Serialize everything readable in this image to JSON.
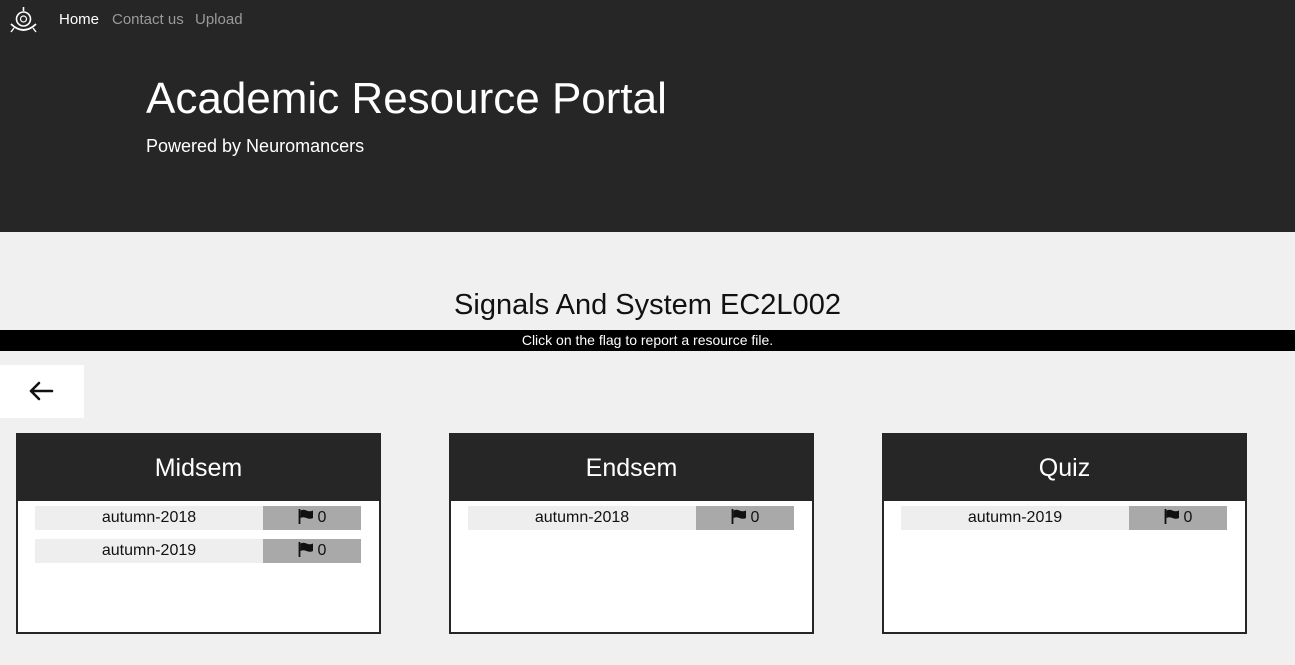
{
  "nav": {
    "logo_icon": "institute-emblem-icon",
    "links": [
      {
        "label": "Home",
        "active": true
      },
      {
        "label": "Contact us",
        "active": false
      },
      {
        "label": "Upload",
        "active": false
      }
    ]
  },
  "hero": {
    "title": "Academic Resource Portal",
    "subtitle": "Powered by Neuromancers"
  },
  "course": {
    "title": "Signals And System EC2L002"
  },
  "notice": "Click on the flag to report a resource file.",
  "back_button": {
    "icon": "arrow-left-icon"
  },
  "colors": {
    "header_bg": "#262626",
    "page_bg": "#f0f0f0",
    "notice_bg": "#000000",
    "flag_cell_bg": "#a9a9a9",
    "file_cell_bg": "#eeeeee"
  },
  "sections": [
    {
      "title": "Midsem",
      "files": [
        {
          "name": "autumn-2018",
          "flags": "0"
        },
        {
          "name": "autumn-2019",
          "flags": "0"
        }
      ]
    },
    {
      "title": "Endsem",
      "files": [
        {
          "name": "autumn-2018",
          "flags": "0"
        }
      ]
    },
    {
      "title": "Quiz",
      "files": [
        {
          "name": "autumn-2019",
          "flags": "0"
        }
      ]
    }
  ]
}
